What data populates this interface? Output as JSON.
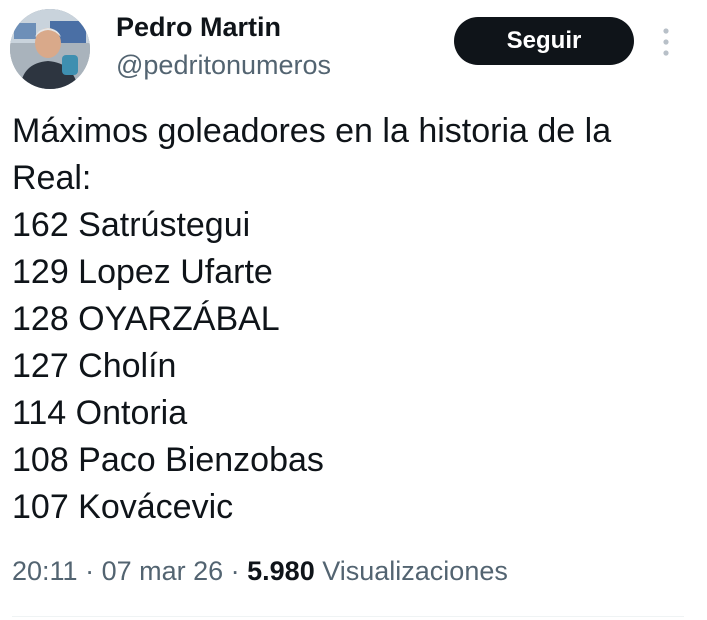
{
  "author": {
    "display_name": "Pedro Martin",
    "handle": "@pedritonumeros",
    "avatar_icon": "user-avatar-photo"
  },
  "follow_button": {
    "label": "Seguir",
    "background": "#0f1419",
    "text_color": "#ffffff"
  },
  "more_icon": "vertical-ellipsis-icon",
  "tweet": {
    "text_lines": [
      "Máximos goleadores en la historia de la",
      "Real:",
      "162 Satrústegui",
      "129 Lopez Ufarte",
      "128 OYARZÁBAL",
      "127 Cholín",
      "114 Ontoria",
      "108 Paco Bienzobas",
      "107 Kovácevic"
    ]
  },
  "meta": {
    "time": "20:11",
    "separator": " · ",
    "date": "07 mar 26",
    "views_count": "5.980",
    "views_label": "Visualizaciones"
  },
  "colors": {
    "primary_text": "#0f1419",
    "secondary_text": "#536471",
    "divider": "#eff3f4"
  }
}
